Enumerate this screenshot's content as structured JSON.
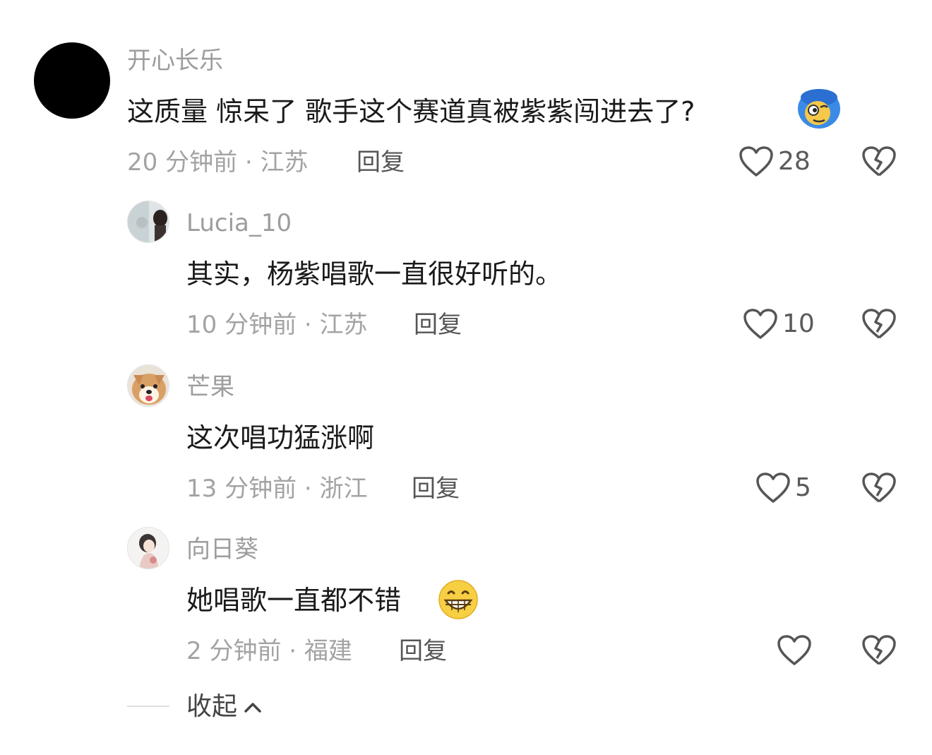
{
  "comments": [
    {
      "username": "开心长乐",
      "text": "这质量 惊呆了 歌手这个赛道真被紫紫闯进去了?",
      "emoji": "blue-hair-emoji",
      "time": "20 分钟前",
      "location": "江苏",
      "reply_label": "回复",
      "likes": "28"
    },
    {
      "username": "Lucia_10",
      "text": "其实，杨紫唱歌一直很好听的。",
      "time": "10 分钟前",
      "location": "江苏",
      "reply_label": "回复",
      "likes": "10"
    },
    {
      "username": "芒果",
      "text": "这次唱功猛涨啊",
      "time": "13 分钟前",
      "location": "浙江",
      "reply_label": "回复",
      "likes": "5"
    },
    {
      "username": "向日葵",
      "text": "她唱歌一直都不错",
      "emoji": "grinning-emoji",
      "time": "2 分钟前",
      "location": "福建",
      "reply_label": "回复",
      "likes": ""
    }
  ],
  "separator": "·",
  "collapse_label": "收起",
  "colors": {
    "meta_gray": "#a3a3a3",
    "text": "#1a1a1a",
    "icon_gray": "#555555"
  }
}
